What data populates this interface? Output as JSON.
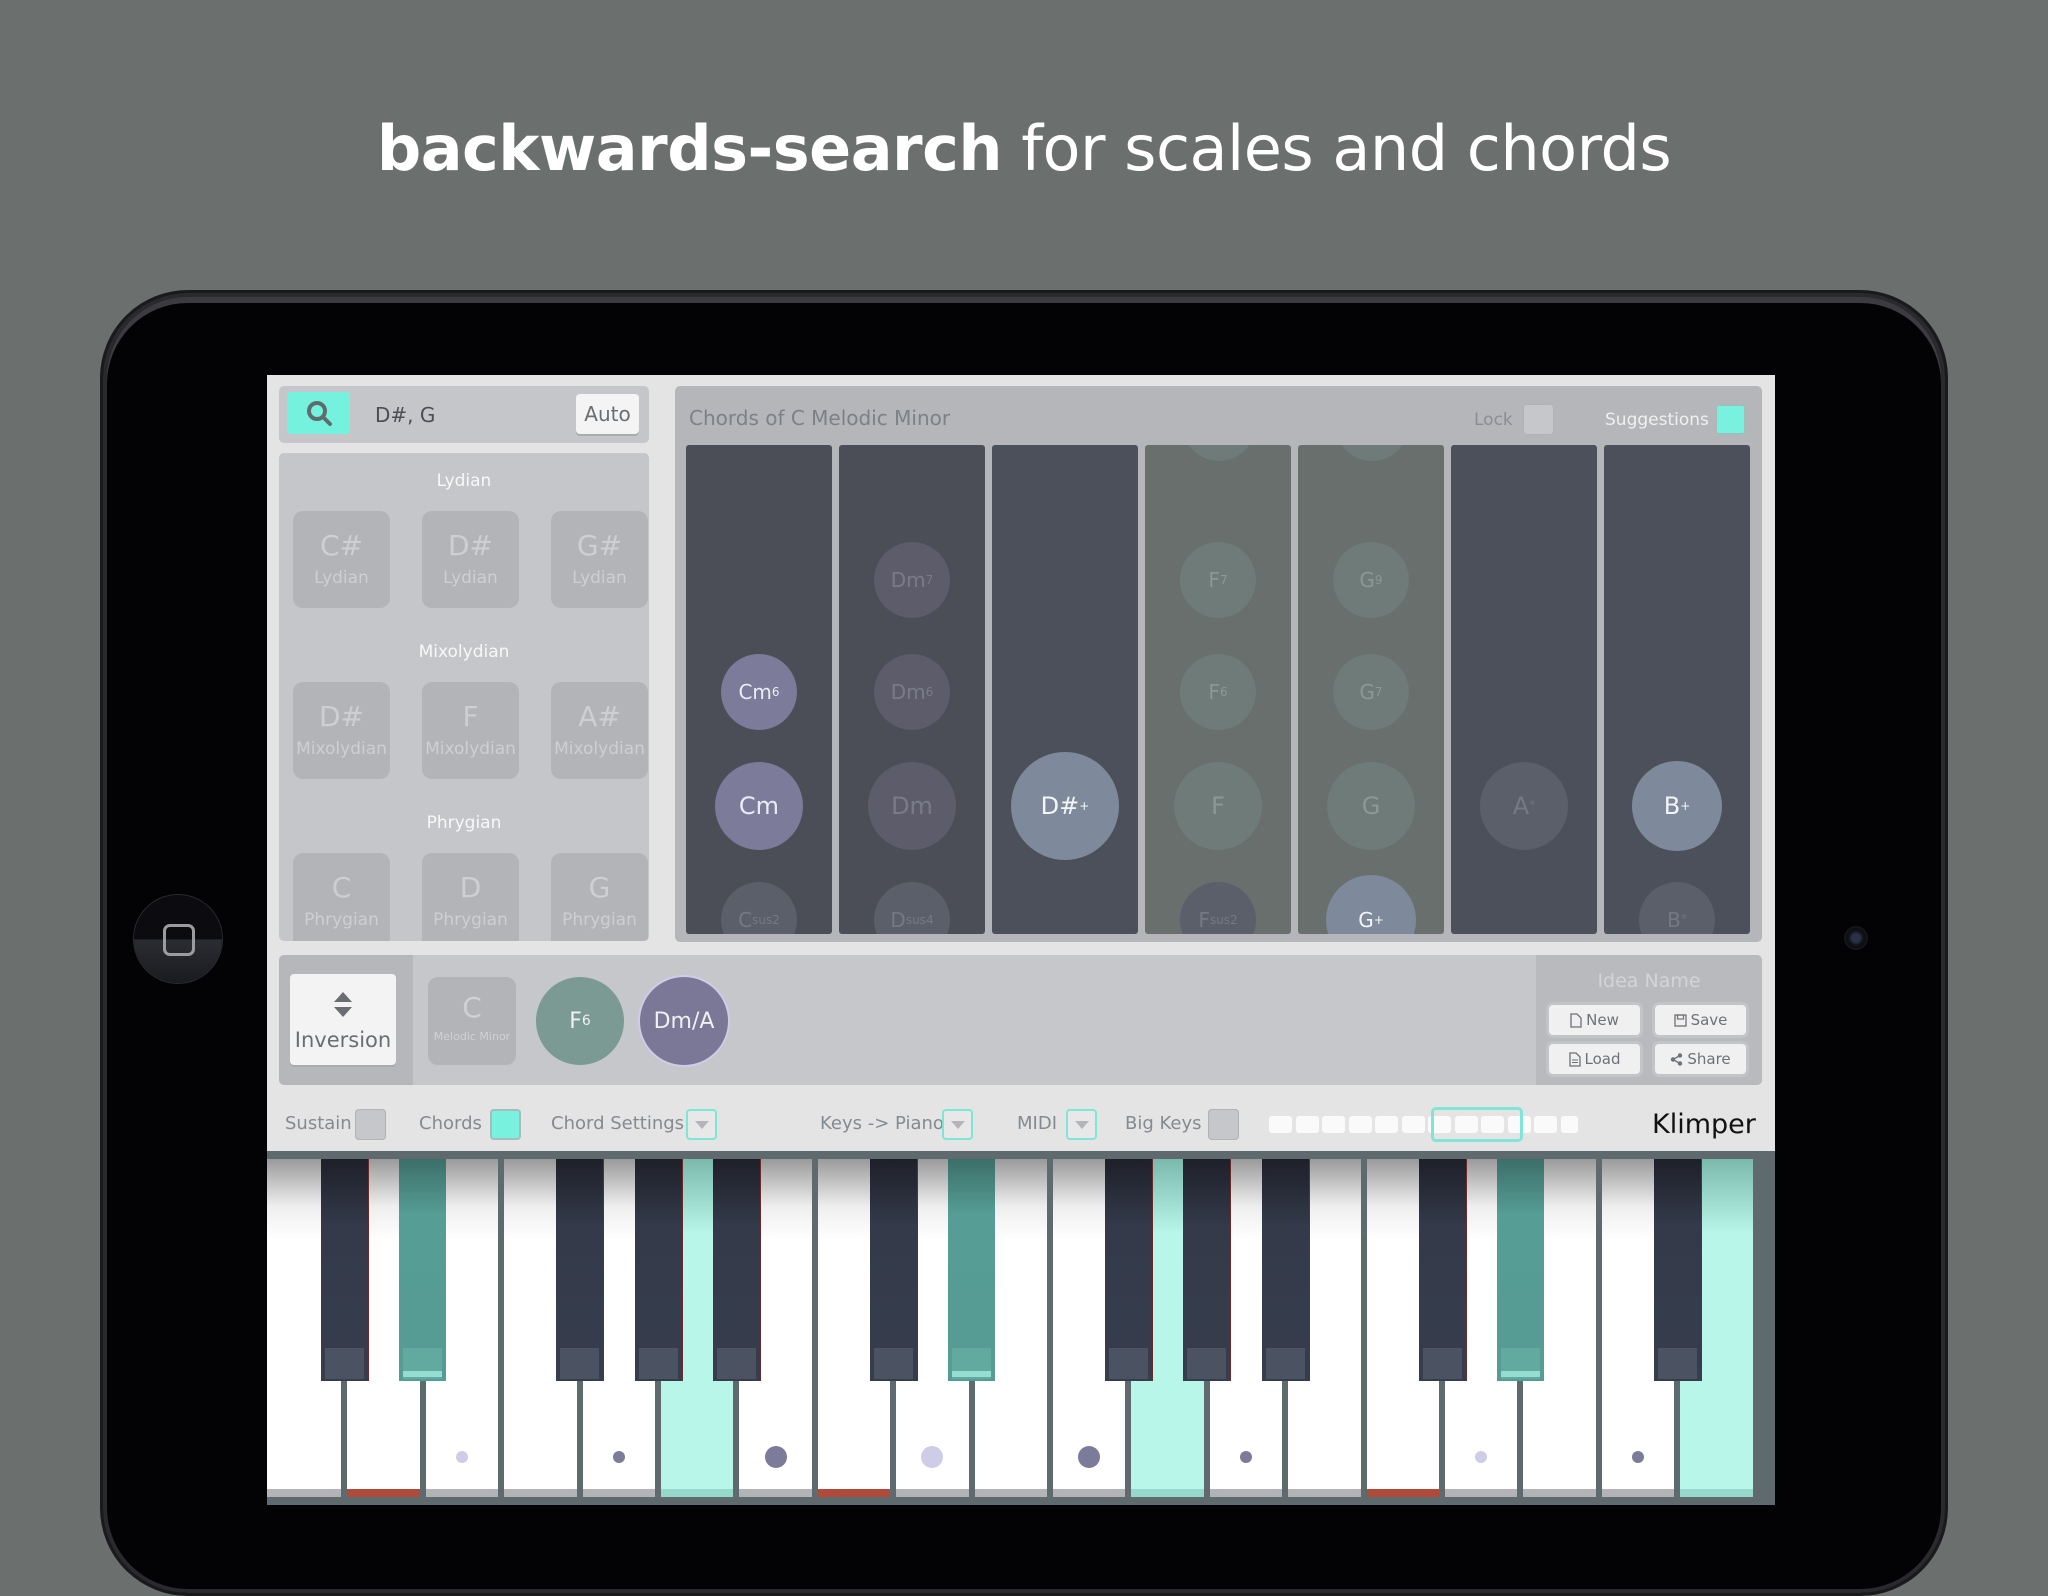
{
  "headline": {
    "bold": "backwards-search",
    "rest": " for scales and chords"
  },
  "search": {
    "query": "D#, G",
    "auto_label": "Auto",
    "icon": "search-icon"
  },
  "scale_groups": [
    {
      "title": "Lydian",
      "scales": [
        {
          "root": "C#",
          "mode": "Lydian"
        },
        {
          "root": "D#",
          "mode": "Lydian"
        },
        {
          "root": "G#",
          "mode": "Lydian"
        }
      ]
    },
    {
      "title": "Mixolydian",
      "scales": [
        {
          "root": "D#",
          "mode": "Mixolydian"
        },
        {
          "root": "F",
          "mode": "Mixolydian"
        },
        {
          "root": "A#",
          "mode": "Mixolydian"
        }
      ]
    },
    {
      "title": "Phrygian",
      "scales": [
        {
          "root": "C",
          "mode": "Phrygian"
        },
        {
          "root": "D",
          "mode": "Phrygian"
        },
        {
          "root": "G",
          "mode": "Phrygian"
        }
      ]
    }
  ],
  "chords_panel": {
    "title": "Chords of C Melodic Minor",
    "lock_label": "Lock",
    "lock_checked": false,
    "suggestions_label": "Suggestions",
    "suggestions_checked": true,
    "columns": [
      {
        "degree": "C",
        "chords": [
          {
            "root": "Cm",
            "ext": "6",
            "state": "active"
          },
          {
            "root": "Cm",
            "ext": "",
            "state": "active"
          },
          {
            "root": "C",
            "ext": "sus2",
            "state": "muted"
          }
        ]
      },
      {
        "degree": "D",
        "chords": [
          {
            "root": "Dm",
            "ext": "7",
            "state": "dim"
          },
          {
            "root": "Dm",
            "ext": "6",
            "state": "dim"
          },
          {
            "root": "Dm",
            "ext": "",
            "state": "dim"
          },
          {
            "root": "D",
            "ext": "sus4",
            "state": "muted"
          }
        ]
      },
      {
        "degree": "D#",
        "chords": [
          {
            "root": "D#",
            "ext": "+",
            "state": "match"
          }
        ]
      },
      {
        "degree": "F",
        "chords": [
          {
            "root": "F",
            "ext": "7",
            "state": "dim"
          },
          {
            "root": "F",
            "ext": "6",
            "state": "dim"
          },
          {
            "root": "F",
            "ext": "",
            "state": "dim"
          },
          {
            "root": "F",
            "ext": "sus2",
            "state": "muted"
          }
        ]
      },
      {
        "degree": "G",
        "chords": [
          {
            "root": "G",
            "ext": "9",
            "state": "dim"
          },
          {
            "root": "G",
            "ext": "7",
            "state": "dim"
          },
          {
            "root": "G",
            "ext": "",
            "state": "dim"
          },
          {
            "root": "G",
            "ext": "+",
            "state": "match"
          }
        ]
      },
      {
        "degree": "A",
        "chords": [
          {
            "root": "A",
            "ext": "°",
            "state": "muted"
          }
        ]
      },
      {
        "degree": "B",
        "chords": [
          {
            "root": "B",
            "ext": "+",
            "state": "match"
          },
          {
            "root": "B",
            "ext": "°",
            "state": "muted"
          }
        ]
      }
    ]
  },
  "progression": {
    "inversion_label": "Inversion",
    "scale_tile": {
      "root": "C",
      "mode": "Melodic Minor"
    },
    "chords": [
      {
        "root": "F",
        "ext": "6",
        "color": "#7a9a93"
      },
      {
        "root": "Dm/A",
        "ext": "",
        "color": "#7a7896"
      }
    ],
    "idea_name_placeholder": "Idea Name",
    "buttons": [
      {
        "label": "New",
        "icon": "file-icon"
      },
      {
        "label": "Save",
        "icon": "floppy-icon"
      },
      {
        "label": "Load",
        "icon": "document-icon"
      },
      {
        "label": "Share",
        "icon": "share-icon"
      }
    ]
  },
  "toolbar": {
    "sustain_label": "Sustain",
    "sustain_checked": false,
    "chords_label": "Chords",
    "chords_checked": true,
    "chord_settings_label": "Chord Settings",
    "keys_piano_label": "Keys -> Piano",
    "midi_label": "MIDI",
    "big_keys_label": "Big Keys",
    "big_keys_checked": false,
    "octave_count": 12,
    "brand": "Klimper"
  },
  "keyboard": {
    "white_keys": [
      {
        "hl": false,
        "base": "grey"
      },
      {
        "hl": false,
        "base": "red"
      },
      {
        "hl": false,
        "base": "grey",
        "dot": "small-light"
      },
      {
        "hl": false,
        "base": "grey"
      },
      {
        "hl": false,
        "base": "grey",
        "dot": "small-dark"
      },
      {
        "hl": true,
        "base": "teal"
      },
      {
        "hl": false,
        "base": "grey",
        "dot": "big-dark"
      },
      {
        "hl": false,
        "base": "red"
      },
      {
        "hl": false,
        "base": "grey",
        "dot": "big-light"
      },
      {
        "hl": false,
        "base": "grey"
      },
      {
        "hl": false,
        "base": "grey",
        "dot": "big-dark"
      },
      {
        "hl": true,
        "base": "teal"
      },
      {
        "hl": false,
        "base": "grey",
        "dot": "small-dark"
      },
      {
        "hl": false,
        "base": "grey"
      },
      {
        "hl": false,
        "base": "red"
      },
      {
        "hl": false,
        "base": "grey",
        "dot": "small-light"
      },
      {
        "hl": false,
        "base": "grey"
      },
      {
        "hl": false,
        "base": "grey",
        "dot": "small-dark"
      },
      {
        "hl": true,
        "base": "teal"
      }
    ],
    "black_keys": [
      {
        "after": 1,
        "hl": false
      },
      {
        "after": 2,
        "hl": true
      },
      {
        "after": 4,
        "hl": false
      },
      {
        "after": 5,
        "hl": false
      },
      {
        "after": 6,
        "hl": false
      },
      {
        "after": 8,
        "hl": false
      },
      {
        "after": 9,
        "hl": true
      },
      {
        "after": 11,
        "hl": false
      },
      {
        "after": 12,
        "hl": false
      },
      {
        "after": 13,
        "hl": false
      },
      {
        "after": 15,
        "hl": false
      },
      {
        "after": 16,
        "hl": true
      },
      {
        "after": 18,
        "hl": false
      }
    ]
  },
  "colors": {
    "accent": "#78f2de",
    "chord_active": "#7d7b9a",
    "chord_match": "#7e8a9b",
    "chord_dim_purple": "#5c5c6a",
    "chord_dim_green": "#6f7b78",
    "chord_muted": "#5b5f6a",
    "dot_dark": "#7d7b9a",
    "dot_light": "#cfcce8"
  }
}
